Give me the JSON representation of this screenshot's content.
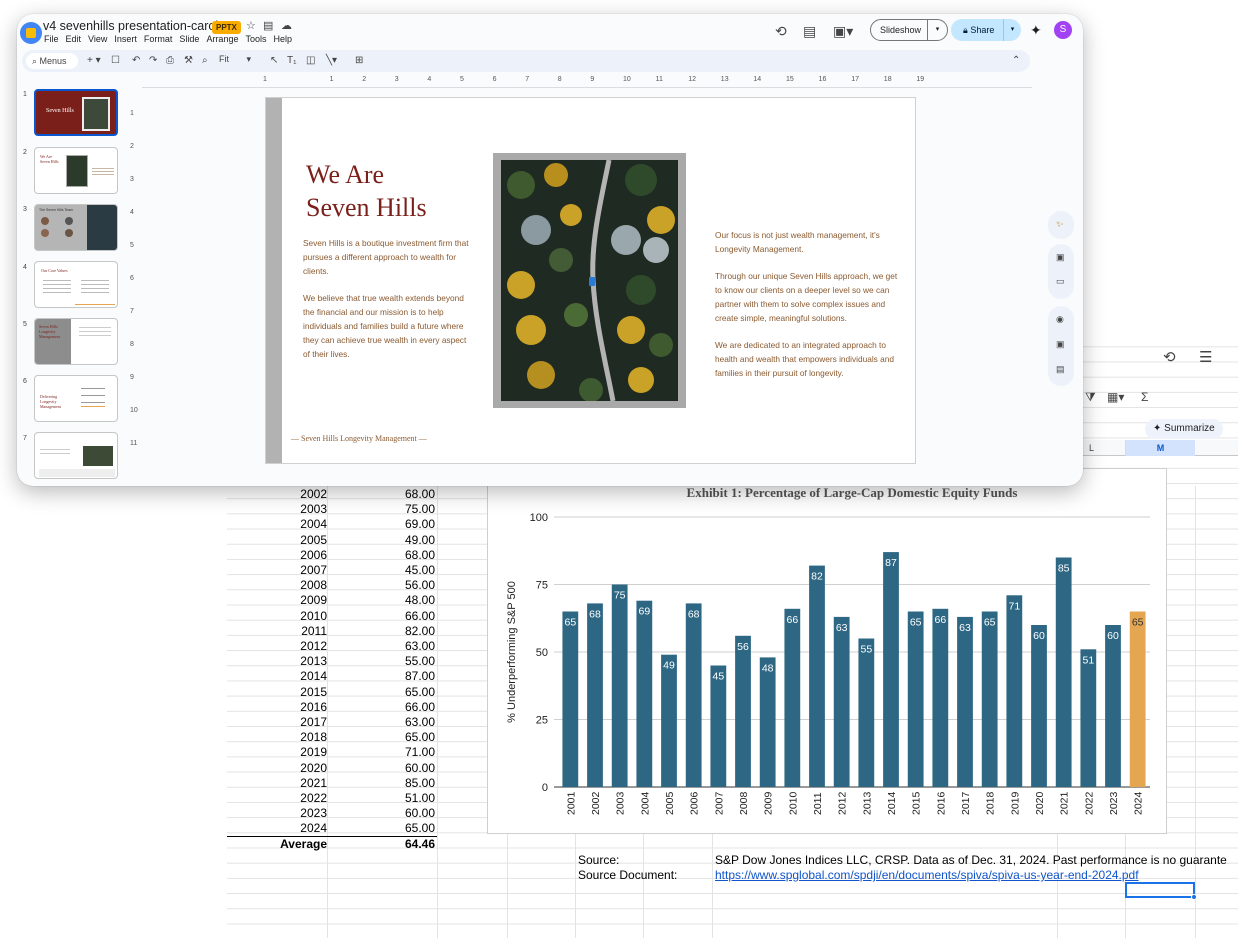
{
  "slides_app": {
    "doc_title": "v4 sevenhills presentation-carolyne",
    "file_badge": "PPTX",
    "menu": [
      "File",
      "Edit",
      "View",
      "Insert",
      "Format",
      "Slide",
      "Arrange",
      "Tools",
      "Help"
    ],
    "slideshow_label": "Slideshow",
    "share_label": "Share",
    "avatar_initial": "S",
    "toolbar": {
      "search_label": "Menus",
      "zoom_label": "Fit"
    },
    "ruler_h": [
      "1",
      "1",
      "2",
      "3",
      "4",
      "5",
      "6",
      "7",
      "8",
      "9",
      "10",
      "11",
      "12",
      "13",
      "14",
      "15",
      "16",
      "17",
      "18",
      "19"
    ],
    "ruler_v": [
      "1",
      "2",
      "3",
      "4",
      "5",
      "6",
      "7",
      "8",
      "9",
      "10",
      "11"
    ],
    "filmstrip": [
      {
        "num": "1",
        "title": "Seven Hills"
      },
      {
        "num": "2",
        "title": "We Are Seven Hills"
      },
      {
        "num": "3",
        "title": "The Seven Hills Team"
      },
      {
        "num": "4",
        "title": "Our Core Values"
      },
      {
        "num": "5",
        "title": "Seven Hills Longevity Management"
      },
      {
        "num": "6",
        "title": "Delivering Longevity Management"
      },
      {
        "num": "7",
        "title": ""
      }
    ],
    "slide": {
      "title": "We Are\nSeven Hills",
      "left_p1": "Seven Hills is a boutique investment firm that pursues a different approach to wealth for clients.",
      "left_p2": "We believe that true wealth extends beyond the financial and our mission is to help individuals and families build a future where they can achieve true wealth in every aspect of their lives.",
      "right_p1": "Our focus is not just wealth management, it's Longevity Management.",
      "right_p2": "Through our unique Seven Hills approach, we get to know our clients on a deeper level so we can partner with them to solve complex issues and create simple, meaningful solutions.",
      "right_p3": "We are dedicated to an integrated approach to health and wealth that empowers individuals and families in their pursuit of longevity.",
      "footer": "— Seven Hills Longevity Management —"
    },
    "colors": {
      "accent": "#7b1f1a",
      "body_text": "#8a5a30",
      "share_bg": "#c2e7ff"
    }
  },
  "sheet_app": {
    "col_headers": [
      "L",
      "M"
    ],
    "summarize_label": "Summarize",
    "rows": [
      {
        "year": "2002",
        "value": "68.00"
      },
      {
        "year": "2003",
        "value": "75.00"
      },
      {
        "year": "2004",
        "value": "69.00"
      },
      {
        "year": "2005",
        "value": "49.00"
      },
      {
        "year": "2006",
        "value": "68.00"
      },
      {
        "year": "2007",
        "value": "45.00"
      },
      {
        "year": "2008",
        "value": "56.00"
      },
      {
        "year": "2009",
        "value": "48.00"
      },
      {
        "year": "2010",
        "value": "66.00"
      },
      {
        "year": "2011",
        "value": "82.00"
      },
      {
        "year": "2012",
        "value": "63.00"
      },
      {
        "year": "2013",
        "value": "55.00"
      },
      {
        "year": "2014",
        "value": "87.00"
      },
      {
        "year": "2015",
        "value": "65.00"
      },
      {
        "year": "2016",
        "value": "66.00"
      },
      {
        "year": "2017",
        "value": "63.00"
      },
      {
        "year": "2018",
        "value": "65.00"
      },
      {
        "year": "2019",
        "value": "71.00"
      },
      {
        "year": "2020",
        "value": "60.00"
      },
      {
        "year": "2021",
        "value": "85.00"
      },
      {
        "year": "2022",
        "value": "51.00"
      },
      {
        "year": "2023",
        "value": "60.00"
      },
      {
        "year": "2024",
        "value": "65.00"
      }
    ],
    "average": {
      "label": "Average",
      "value": "64.46"
    },
    "source_label": "Source:",
    "source_text": "S&P Dow Jones Indices LLC, CRSP. Data as of Dec. 31, 2024. Past performance is no guarante",
    "source_doc_label": "Source Document:",
    "source_doc_link": "https://www.spglobal.com/spdji/en/documents/spiva/spiva-us-year-end-2024.pdf"
  },
  "chart_data": {
    "type": "bar",
    "title": "Exhibit 1: Percentage of Large-Cap Domestic Equity Funds",
    "ylabel": "% Underperforming S&P 500",
    "xlabel": "",
    "ylim": [
      0,
      100
    ],
    "yticks": [
      "0",
      "25",
      "50",
      "75",
      "100"
    ],
    "categories": [
      "2001",
      "2002",
      "2003",
      "2004",
      "2005",
      "2006",
      "2007",
      "2008",
      "2009",
      "2010",
      "2011",
      "2012",
      "2013",
      "2014",
      "2015",
      "2016",
      "2017",
      "2018",
      "2019",
      "2020",
      "2021",
      "2022",
      "2023",
      "2024"
    ],
    "values": [
      65,
      68,
      75,
      69,
      49,
      68,
      45,
      56,
      48,
      66,
      82,
      63,
      55,
      87,
      65,
      66,
      63,
      65,
      71,
      60,
      85,
      51,
      60,
      65
    ],
    "bar_color": "#2e6784",
    "highlight_color": "#e4a650",
    "highlight_index": 23,
    "grid": true
  }
}
